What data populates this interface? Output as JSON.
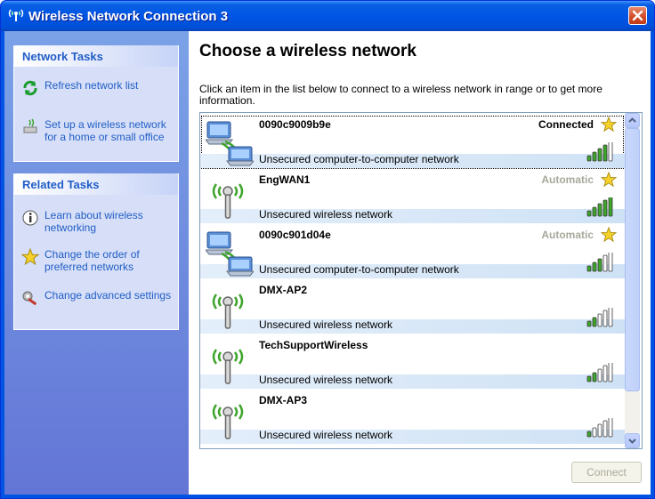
{
  "window": {
    "title": "Wireless Network Connection 3",
    "close_label": "✕"
  },
  "sidebar": {
    "network_tasks": {
      "header": "Network Tasks",
      "items": [
        {
          "label": "Refresh network list",
          "icon": "refresh-icon"
        },
        {
          "label": "Set up a wireless network for a home or small office",
          "icon": "setup-wireless-icon"
        }
      ]
    },
    "related_tasks": {
      "header": "Related Tasks",
      "items": [
        {
          "label": "Learn about wireless networking",
          "icon": "info-icon"
        },
        {
          "label": "Change the order of preferred networks",
          "icon": "star-icon"
        },
        {
          "label": "Change advanced settings",
          "icon": "settings-icon"
        }
      ]
    }
  },
  "main": {
    "title": "Choose a wireless network",
    "description": "Click an item in the list below to connect to a wireless network in range or to get more information.",
    "networks": [
      {
        "name": "0090c9009b9e",
        "status": "Connected",
        "security": "Unsecured computer-to-computer network",
        "type": "computer-to-computer",
        "signal_bars": 4,
        "preferred": true,
        "selected": true
      },
      {
        "name": "EngWAN1",
        "status": "Automatic",
        "security": "Unsecured wireless network",
        "type": "access-point",
        "signal_bars": 5,
        "preferred": true,
        "selected": false
      },
      {
        "name": "0090c901d04e",
        "status": "Automatic",
        "security": "Unsecured computer-to-computer network",
        "type": "computer-to-computer",
        "signal_bars": 3,
        "preferred": true,
        "selected": false
      },
      {
        "name": "DMX-AP2",
        "status": "",
        "security": "Unsecured wireless network",
        "type": "access-point",
        "signal_bars": 2,
        "preferred": false,
        "selected": false
      },
      {
        "name": "TechSupportWireless",
        "status": "",
        "security": "Unsecured wireless network",
        "type": "access-point",
        "signal_bars": 2,
        "preferred": false,
        "selected": false
      },
      {
        "name": "DMX-AP3",
        "status": "",
        "security": "Unsecured wireless network",
        "type": "access-point",
        "signal_bars": 1,
        "preferred": false,
        "selected": false
      }
    ],
    "connect_button": "Connect"
  },
  "colors": {
    "link": "#215dc6",
    "connected_status": "#000000",
    "automatic_status": "#a8a89c",
    "signal_on": "#3ea52b",
    "signal_off": "#ffffff"
  }
}
